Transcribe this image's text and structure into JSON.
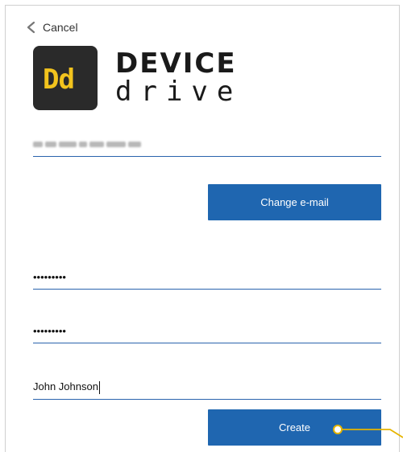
{
  "header": {
    "cancel_label": "Cancel"
  },
  "logo": {
    "icon_text": "Dd",
    "wordmark_top": "DEVICE",
    "wordmark_bottom": "drive"
  },
  "form": {
    "email_value": "",
    "password_mask": "•••••••••",
    "confirm_password_mask": "•••••••••",
    "name_value": "John Johnson"
  },
  "buttons": {
    "change_email_label": "Change e-mail",
    "create_label": "Create"
  },
  "colors": {
    "accent": "#1f66b0",
    "logo_yellow": "#f2c31d",
    "annotation": "#e6b400"
  }
}
